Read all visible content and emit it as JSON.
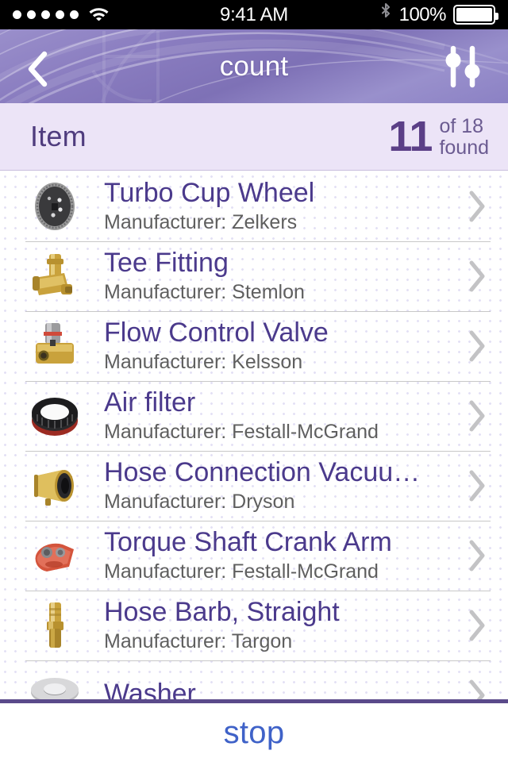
{
  "statusbar": {
    "signal_dots": 5,
    "wifi_icon": "wifi-icon",
    "time": "9:41 AM",
    "bluetooth_icon": "bluetooth-icon",
    "battery_percent": "100%",
    "battery_icon": "battery-full-icon"
  },
  "navbar": {
    "back_icon": "chevron-left-icon",
    "title": "count",
    "filter_icon": "sliders-icon",
    "bg_color": "#8a7dc0"
  },
  "subheader": {
    "label": "Item",
    "count": "11",
    "of_total": "of 18",
    "found_label": "found",
    "bg_color": "#ece4f7",
    "count_color": "#5b3f87"
  },
  "list": {
    "manufacturer_prefix": "Manufacturer: ",
    "chevron_icon": "chevron-right-icon",
    "title_color": "#4b3a8c",
    "items": [
      {
        "title": "Turbo Cup Wheel",
        "subtitle": "Manufacturer: Zelkers",
        "thumb": "grinding-wheel-thumb"
      },
      {
        "title": "Tee Fitting",
        "subtitle": "Manufacturer: Stemlon",
        "thumb": "brass-tee-fitting-thumb"
      },
      {
        "title": "Flow Control Valve",
        "subtitle": "Manufacturer: Kelsson",
        "thumb": "flow-control-valve-thumb"
      },
      {
        "title": "Air filter",
        "subtitle": "Manufacturer: Festall-McGrand",
        "thumb": "air-filter-thumb"
      },
      {
        "title": "Hose Connection Vacuu…",
        "subtitle": "Manufacturer: Dryson",
        "thumb": "hose-connection-thumb"
      },
      {
        "title": "Torque Shaft Crank Arm",
        "subtitle": "Manufacturer: Festall-McGrand",
        "thumb": "crank-arm-thumb"
      },
      {
        "title": "Hose Barb, Straight",
        "subtitle": "Manufacturer: Targon",
        "thumb": "hose-barb-thumb"
      },
      {
        "title": "Washer",
        "subtitle": "",
        "thumb": "washer-thumb"
      }
    ]
  },
  "footer": {
    "stop_label": "stop",
    "link_color": "#3f62c8",
    "border_color": "#5a4a8a"
  }
}
